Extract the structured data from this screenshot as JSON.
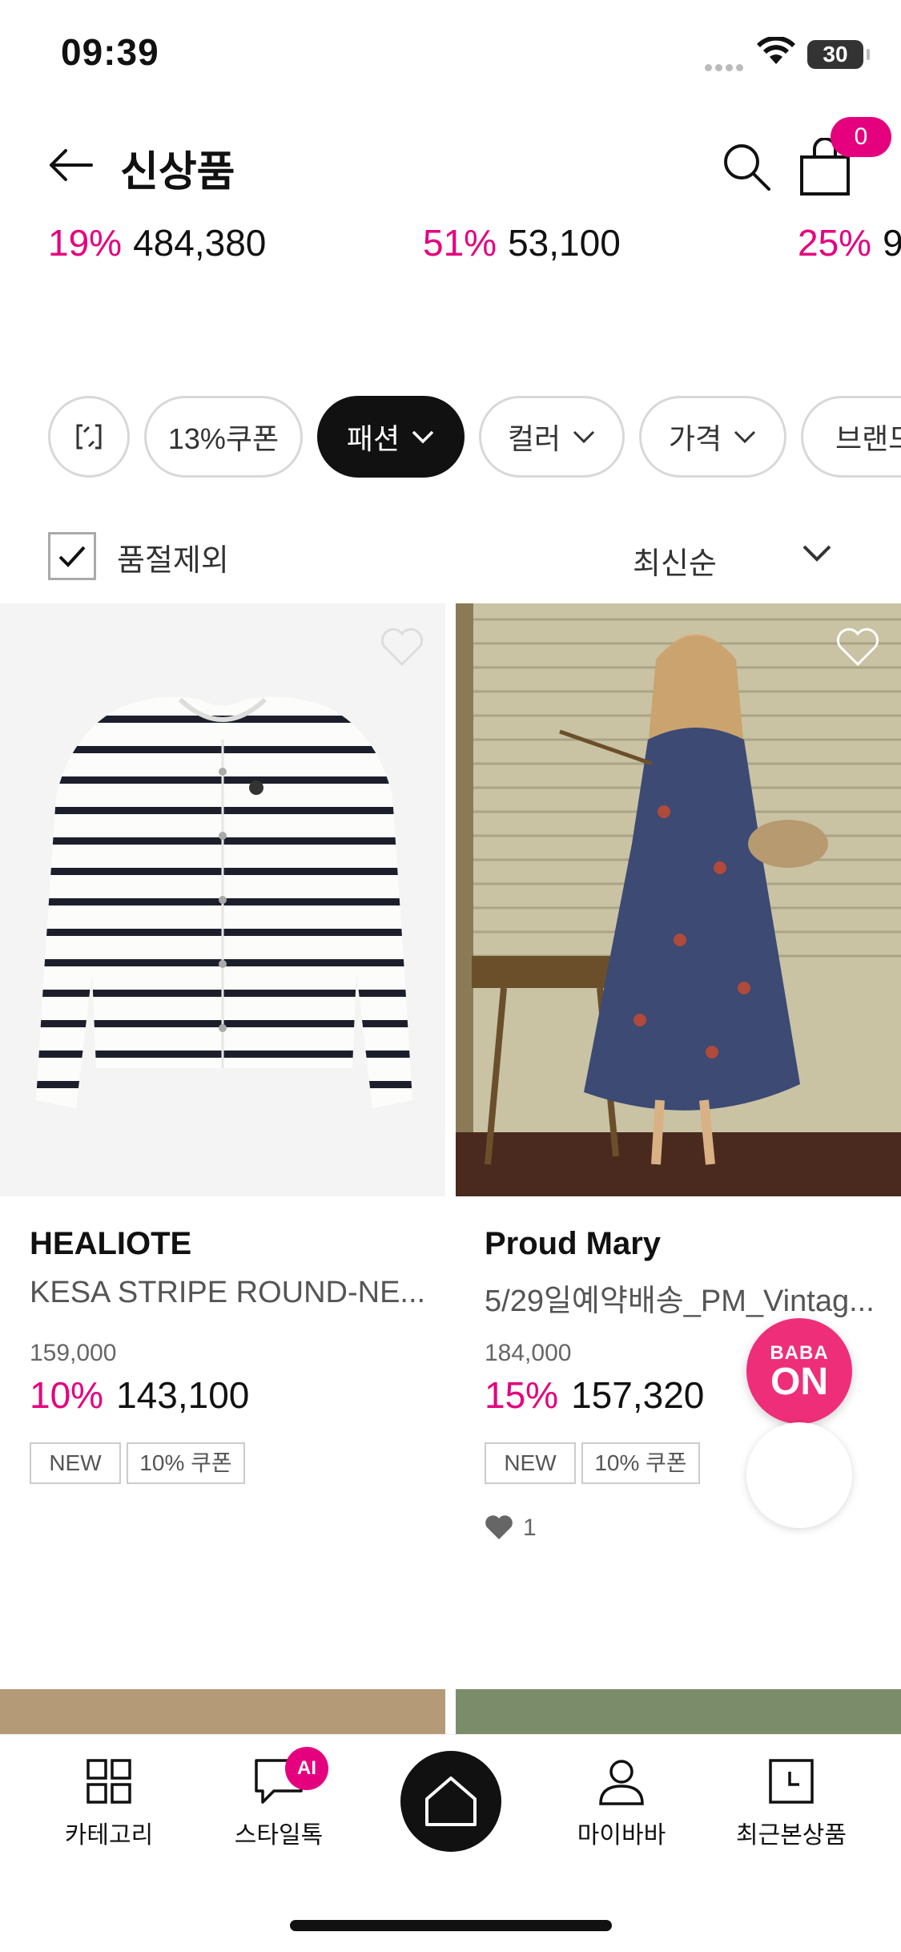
{
  "status": {
    "time": "09:39",
    "battery": "30"
  },
  "header": {
    "title": "신상품",
    "cart_count": "0"
  },
  "price_strip": [
    {
      "pct": "19%",
      "price": "484,380"
    },
    {
      "pct": "51%",
      "price": "53,100"
    },
    {
      "pct": "25%",
      "price": "9"
    }
  ],
  "filters": [
    {
      "label": "13%쿠폰"
    },
    {
      "label": "패션"
    },
    {
      "label": "컬러"
    },
    {
      "label": "가격"
    },
    {
      "label": "브랜드"
    }
  ],
  "options": {
    "exclude_soldout": "품절제외",
    "sort": "최신순"
  },
  "products": [
    {
      "brand": "HEALIOTE",
      "name": "KESA STRIPE ROUND-NE...",
      "original_price": "159,000",
      "discount": "10%",
      "price": "143,100",
      "tags": [
        "NEW",
        "10% 쿠폰"
      ]
    },
    {
      "brand": "Proud Mary",
      "name": "5/29일예약배송_PM_Vintag...",
      "original_price": "184,000",
      "discount": "15%",
      "price": "157,320",
      "tags": [
        "NEW",
        "10% 쿠폰"
      ],
      "likes": "1"
    }
  ],
  "floating": {
    "baba_line1": "BABA",
    "baba_line2": "ON"
  },
  "nav": {
    "category": "카테고리",
    "styletalk": "스타일톡",
    "ai_badge": "AI",
    "mybaba": "마이바바",
    "recent": "최근본상품"
  },
  "colors": {
    "accent": "#e5007e",
    "dark": "#111111"
  }
}
